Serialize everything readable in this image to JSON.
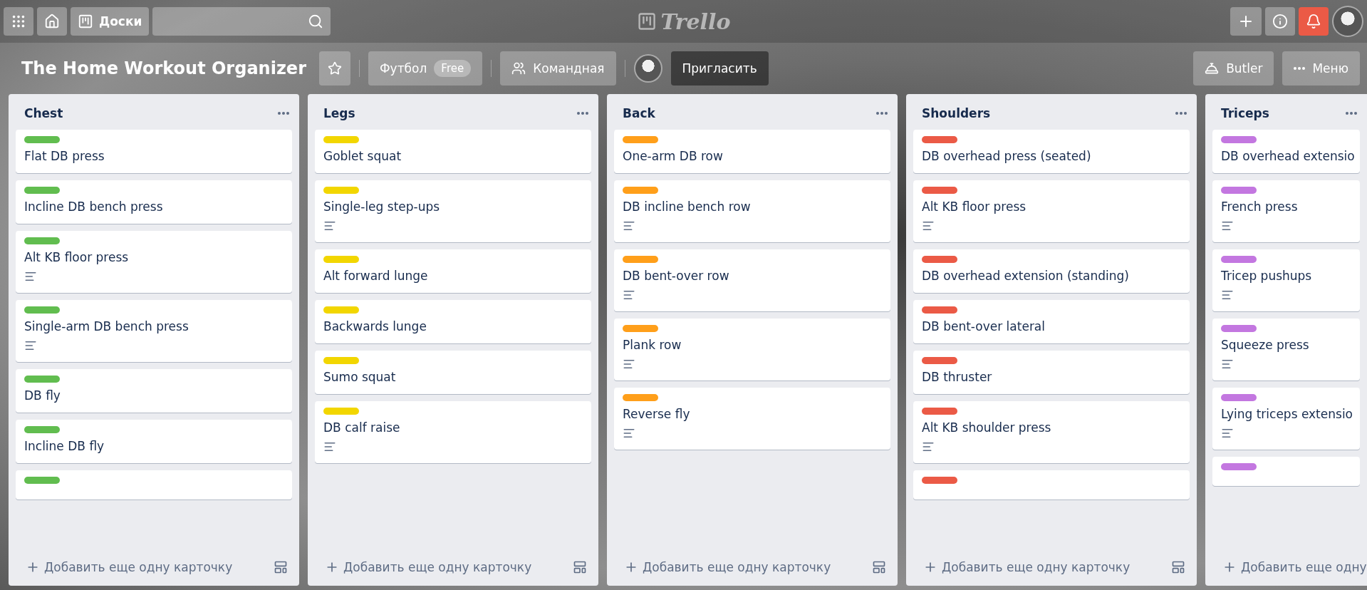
{
  "top_bar": {
    "boards_button": "Доски",
    "logo": "Trello",
    "notifications_alert": true
  },
  "board_bar": {
    "title": "The Home Workout Organizer",
    "starred": false,
    "workspace": "Футбол",
    "workspace_badge": "Free",
    "visibility": "Командная",
    "invite": "Пригласить",
    "butler": "Butler",
    "menu": "Меню"
  },
  "lists": [
    {
      "title": "Chest",
      "add_card": "Добавить еще одну карточку",
      "cards": [
        {
          "title": "Flat DB press",
          "color": "#61bd4f",
          "description": false
        },
        {
          "title": "Incline DB bench press",
          "color": "#61bd4f",
          "description": false
        },
        {
          "title": "Alt KB floor press",
          "color": "#61bd4f",
          "description": true
        },
        {
          "title": "Single-arm DB bench press",
          "color": "#61bd4f",
          "description": true
        },
        {
          "title": "DB fly",
          "color": "#61bd4f",
          "description": false
        },
        {
          "title": "Incline DB fly",
          "color": "#61bd4f",
          "description": false
        },
        {
          "color": "#61bd4f",
          "description": false
        }
      ]
    },
    {
      "title": "Legs",
      "add_card": "Добавить еще одну карточку",
      "cards": [
        {
          "title": "Goblet squat",
          "color": "#f2d600",
          "description": false
        },
        {
          "title": "Single-leg step-ups",
          "color": "#f2d600",
          "description": true
        },
        {
          "title": "Alt forward lunge",
          "color": "#f2d600",
          "description": false
        },
        {
          "title": "Backwards lunge",
          "color": "#f2d600",
          "description": false
        },
        {
          "title": "Sumo squat",
          "color": "#f2d600",
          "description": false
        },
        {
          "title": "DB calf raise",
          "color": "#f2d600",
          "description": true
        }
      ]
    },
    {
      "title": "Back",
      "add_card": "Добавить еще одну карточку",
      "cards": [
        {
          "title": "One-arm DB row",
          "color": "#ff9f1a",
          "description": false
        },
        {
          "title": "DB incline bench row",
          "color": "#ff9f1a",
          "description": true
        },
        {
          "title": "DB bent-over row",
          "color": "#ff9f1a",
          "description": true
        },
        {
          "title": "Plank row",
          "color": "#ff9f1a",
          "description": true
        },
        {
          "title": "Reverse fly",
          "color": "#ff9f1a",
          "description": true
        }
      ]
    },
    {
      "title": "Shoulders",
      "add_card": "Добавить еще одну карточку",
      "cards": [
        {
          "title": "DB overhead press (seated)",
          "color": "#eb5a46",
          "description": false
        },
        {
          "title": "Alt KB floor press",
          "color": "#eb5a46",
          "description": true
        },
        {
          "title": "DB overhead extension (standing)",
          "color": "#eb5a46",
          "description": false
        },
        {
          "title": "DB bent-over lateral",
          "color": "#eb5a46",
          "description": false
        },
        {
          "title": "DB thruster",
          "color": "#eb5a46",
          "description": false
        },
        {
          "title": "Alt KB shoulder press",
          "color": "#eb5a46",
          "description": true
        },
        {
          "color": "#eb5a46",
          "description": false
        }
      ]
    },
    {
      "title": "Triceps",
      "add_card": "Добавить еще одну",
      "cards": [
        {
          "title": "DB overhead extensio",
          "color": "#c377e0",
          "description": false
        },
        {
          "title": "French press",
          "color": "#c377e0",
          "description": true
        },
        {
          "title": "Tricep pushups",
          "color": "#c377e0",
          "description": true
        },
        {
          "title": "Squeeze press",
          "color": "#c377e0",
          "description": true
        },
        {
          "title": "Lying triceps extensio",
          "color": "#c377e0",
          "description": true
        },
        {
          "color": "#c377e0",
          "description": false
        }
      ]
    }
  ]
}
